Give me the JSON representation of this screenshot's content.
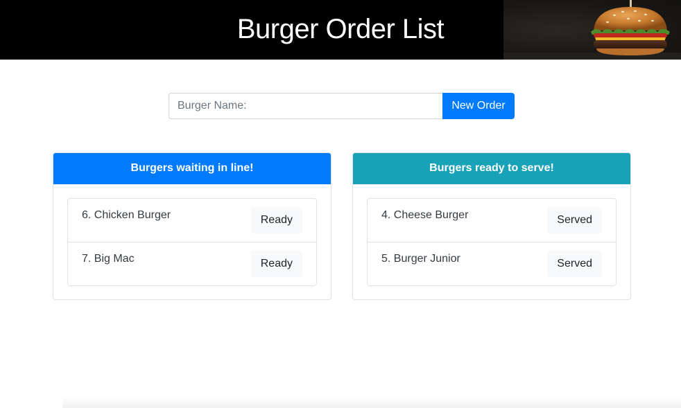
{
  "header": {
    "title": "Burger Order List",
    "image": "burger-photo"
  },
  "order_form": {
    "placeholder": "Burger Name:",
    "value": "",
    "submit_label": "New Order"
  },
  "waiting": {
    "title": "Burgers waiting in line!",
    "items": [
      {
        "label": "6. Chicken Burger",
        "action": "Ready"
      },
      {
        "label": "7. Big Mac",
        "action": "Ready"
      }
    ]
  },
  "ready": {
    "title": "Burgers ready to serve!",
    "items": [
      {
        "label": "4. Cheese Burger",
        "action": "Served"
      },
      {
        "label": "5. Burger Junior",
        "action": "Served"
      }
    ]
  },
  "colors": {
    "header_bg": "#000000",
    "primary": "#007bff",
    "info": "#17a2b8",
    "light": "#f8f9fa"
  }
}
